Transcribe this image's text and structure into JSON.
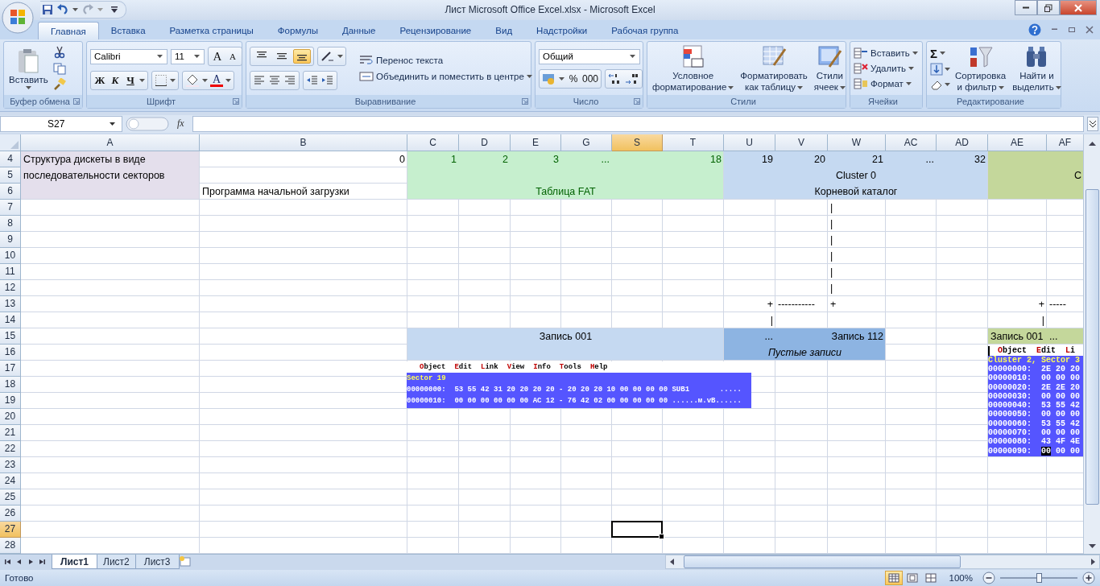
{
  "window": {
    "title": "Лист Microsoft Office Excel.xlsx - Microsoft Excel"
  },
  "tabs": [
    {
      "label": "Главная",
      "selected": true
    },
    {
      "label": "Вставка",
      "selected": false
    },
    {
      "label": "Разметка страницы",
      "selected": false
    },
    {
      "label": "Формулы",
      "selected": false
    },
    {
      "label": "Данные",
      "selected": false
    },
    {
      "label": "Рецензирование",
      "selected": false
    },
    {
      "label": "Вид",
      "selected": false
    },
    {
      "label": "Надстройки",
      "selected": false
    },
    {
      "label": "Рабочая группа",
      "selected": false
    }
  ],
  "ribbon": {
    "clipboard": {
      "paste": "Вставить",
      "label": "Буфер обмена"
    },
    "font": {
      "family": "Calibri",
      "size": "11",
      "grow": "A",
      "shrink": "A",
      "bold": "Ж",
      "italic": "К",
      "underline": "Ч",
      "font_color": "A",
      "label": "Шрифт"
    },
    "alignment": {
      "vertical_align": [
        {
          "selected": false
        },
        {
          "selected": false
        },
        {
          "selected": true
        }
      ],
      "wrap": "Перенос текста",
      "merge": "Объединить и поместить в центре",
      "label": "Выравнивание"
    },
    "number": {
      "format": "Общий",
      "percent": "%",
      "thousands": "000",
      "label": "Число"
    },
    "styles": {
      "buttons": [
        {
          "lines": [
            "Условное",
            "форматирование"
          ]
        },
        {
          "lines": [
            "Форматировать",
            "как таблицу"
          ]
        },
        {
          "lines": [
            "Стили",
            "ячеек"
          ]
        }
      ],
      "label": "Стили"
    },
    "cells": {
      "buttons": [
        "Вставить",
        "Удалить",
        "Формат"
      ],
      "label": "Ячейки"
    },
    "editing": {
      "sum": "Σ",
      "buttons": [
        {
          "lines": [
            "Сортировка",
            "и фильтр"
          ]
        },
        {
          "lines": [
            "Найти и",
            "выделить"
          ]
        }
      ],
      "label": "Редактирование"
    }
  },
  "formula_bar": {
    "name_box": "S27",
    "fx": "fx"
  },
  "sheet": {
    "columns": [
      {
        "label": "A",
        "selected": false
      },
      {
        "label": "B",
        "selected": false
      },
      {
        "label": "C",
        "selected": false
      },
      {
        "label": "D",
        "selected": false
      },
      {
        "label": "E",
        "selected": false
      },
      {
        "label": "G",
        "selected": false
      },
      {
        "label": "S",
        "selected": true
      },
      {
        "label": "T",
        "selected": false
      },
      {
        "label": "U",
        "selected": false
      },
      {
        "label": "V",
        "selected": false
      },
      {
        "label": "W",
        "selected": false
      },
      {
        "label": "AC",
        "selected": false
      },
      {
        "label": "AD",
        "selected": false
      },
      {
        "label": "AE",
        "selected": false
      },
      {
        "label": "AF",
        "selected": false
      }
    ],
    "rows": [
      {
        "label": "4",
        "selected": false
      },
      {
        "label": "5",
        "selected": false
      },
      {
        "label": "6",
        "selected": false
      },
      {
        "label": "7",
        "selected": false
      },
      {
        "label": "8",
        "selected": false
      },
      {
        "label": "9",
        "selected": false
      },
      {
        "label": "10",
        "selected": false
      },
      {
        "label": "11",
        "selected": false
      },
      {
        "label": "12",
        "selected": false
      },
      {
        "label": "13",
        "selected": false
      },
      {
        "label": "14",
        "selected": false
      },
      {
        "label": "15",
        "selected": false
      },
      {
        "label": "16",
        "selected": false
      },
      {
        "label": "17",
        "selected": false
      },
      {
        "label": "18",
        "selected": false
      },
      {
        "label": "19",
        "selected": false
      },
      {
        "label": "20",
        "selected": false
      },
      {
        "label": "21",
        "selected": false
      },
      {
        "label": "22",
        "selected": false
      },
      {
        "label": "23",
        "selected": false
      },
      {
        "label": "24",
        "selected": false
      },
      {
        "label": "25",
        "selected": false
      },
      {
        "label": "26",
        "selected": false
      },
      {
        "label": "27",
        "selected": true
      },
      {
        "label": "28",
        "selected": false
      }
    ],
    "regions": {
      "A4:A6": {
        "kind": "header"
      },
      "C4:T6": {
        "kind": "fat"
      },
      "U4:AD6": {
        "kind": "root"
      },
      "AE4:AF6": {
        "kind": "data"
      },
      "C15:T16": {
        "kind": "root"
      },
      "U15:W16": {
        "kind": "empty"
      },
      "AE15:AF15": {
        "kind": "data"
      }
    },
    "cells": {
      "A4:A6": {
        "text": "Структура дискеты в виде последовательности секторов",
        "kind": "text"
      },
      "B4": {
        "text": "0",
        "kind": "value"
      },
      "B6": {
        "text": "Программа начальной загрузки",
        "kind": "text"
      },
      "C4": {
        "text": "1",
        "kind": "fat_value"
      },
      "D4": {
        "text": "2",
        "kind": "fat_value"
      },
      "E4": {
        "text": "3",
        "kind": "fat_value"
      },
      "G4": {
        "text": "...",
        "kind": "fat_value"
      },
      "T4": {
        "text": "18",
        "kind": "fat_value"
      },
      "C6:T6": {
        "text": "Таблица FAT",
        "kind": "fat_heading"
      },
      "U4": {
        "text": "19",
        "kind": "value"
      },
      "V4": {
        "text": "20",
        "kind": "value"
      },
      "W4": {
        "text": "21",
        "kind": "value"
      },
      "AC4": {
        "text": "...",
        "kind": "value"
      },
      "AD4": {
        "text": "32",
        "kind": "value"
      },
      "U5:AD5": {
        "text": "Cluster 0",
        "kind": "heading"
      },
      "U6:AD6": {
        "text": "Корневой каталог",
        "kind": "heading"
      },
      "AF5": {
        "text": "C",
        "kind": "value"
      },
      "W7": {
        "text": "|",
        "kind": "text"
      },
      "W8": {
        "text": "|",
        "kind": "text"
      },
      "W9": {
        "text": "|",
        "kind": "text"
      },
      "W10": {
        "text": "|",
        "kind": "text"
      },
      "W11": {
        "text": "|",
        "kind": "text"
      },
      "W12": {
        "text": "|",
        "kind": "text"
      },
      "U13": {
        "text": "+",
        "kind": "value"
      },
      "V13": {
        "text": "-----------",
        "kind": "text"
      },
      "W13": {
        "text": "+",
        "kind": "text"
      },
      "AE13": {
        "text": "+",
        "kind": "value"
      },
      "AF13": {
        "text": "-----",
        "kind": "text"
      },
      "U14": {
        "text": "|",
        "kind": "value"
      },
      "AE14": {
        "text": "|",
        "kind": "value"
      },
      "C15:T15": {
        "text": "Запись 001",
        "kind": "heading"
      },
      "U15": {
        "text": "...",
        "kind": "value"
      },
      "W15": {
        "text": "Запись 112",
        "kind": "value"
      },
      "U16:W16": {
        "text": "Пустые записи",
        "kind": "note"
      },
      "AE15": {
        "text": "Запись 001",
        "kind": "text"
      },
      "AF15": {
        "text": "...",
        "kind": "text"
      }
    },
    "hex_views": {
      "C17:V19": {
        "menu": [
          "Object",
          "Edit",
          "Link",
          "View",
          "Info",
          "Tools",
          "Help"
        ],
        "title": "Sector 19",
        "lines": [
          {
            "text": "00000000:  53 55 42 31 20 20 20 20 - 20 20 20 10 00 00 00 00 SUB1       ....."
          },
          {
            "text": "00000010:  00 00 00 00 00 00 AC 12 - 76 42 02 00 00 00 00 00 ......м.vB......"
          }
        ]
      },
      "AE16:AF22": {
        "menu": [
          "Object",
          "Edit",
          "Li"
        ],
        "title": "Cluster 2, Sector 3",
        "lines": [
          {
            "text": "00000000:  2E 20 20"
          },
          {
            "text": "00000010:  00 00 00"
          },
          {
            "text": "00000020:  2E 2E 20"
          },
          {
            "text": "00000030:  00 00 00"
          },
          {
            "text": "00000040:  53 55 42"
          },
          {
            "text": "00000050:  00 00 00"
          },
          {
            "text": "00000060:  53 55 42"
          },
          {
            "text": "00000070:  00 00 00"
          },
          {
            "text": "00000080:  43 4F 4E"
          },
          {
            "text": "00000090:  ",
            "cursor": "00",
            "rest": " 00 00"
          }
        ]
      }
    }
  },
  "sheet_tabs": [
    {
      "label": "Лист1",
      "selected": true
    },
    {
      "label": "Лист2",
      "selected": false
    },
    {
      "label": "Лист3",
      "selected": false
    }
  ],
  "status_bar": {
    "status": "Готово",
    "views": [
      {
        "selected": true
      },
      {
        "selected": false
      },
      {
        "selected": false
      }
    ],
    "zoom": {
      "reading": "100%",
      "level": 0.5
    }
  }
}
